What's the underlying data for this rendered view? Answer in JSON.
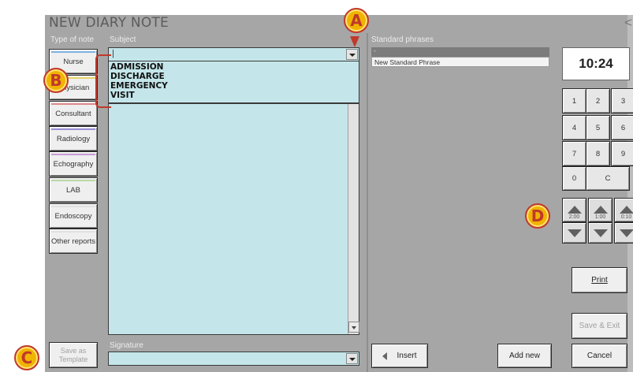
{
  "window": {
    "title": "NEW DIARY NOTE",
    "close_glyph": "<"
  },
  "type_of_note": {
    "label": "Type of note",
    "items": [
      {
        "label": "Nurse",
        "stripe": "#7fb3e0"
      },
      {
        "label": "Physician",
        "stripe": "#e6d36b"
      },
      {
        "label": "Consultant",
        "stripe": "#e08a8a"
      },
      {
        "label": "Radiology",
        "stripe": "#9a8fd6"
      },
      {
        "label": "Echography",
        "stripe": "#c79bd6"
      },
      {
        "label": "LAB",
        "stripe": "#b8d8a8"
      },
      {
        "label": "Endoscopy",
        "stripe": "#e0e0e0"
      },
      {
        "label": "Other reports",
        "stripe": "#e0e0e0"
      }
    ],
    "save_template_label": "Save as Template"
  },
  "subject": {
    "label": "Subject",
    "value": "|",
    "options": [
      "ADMISSION",
      "DISCHARGE",
      "EMERGENCY",
      "VISIT"
    ]
  },
  "signature": {
    "label": "Signature",
    "value": ""
  },
  "standard_phrases": {
    "label": "Standard phrases",
    "items": [
      "-",
      "New Standard Phrase"
    ],
    "insert_label": "Insert",
    "add_new_label": "Add new"
  },
  "time": {
    "value": "10:24",
    "keys": [
      "1",
      "2",
      "3",
      "4",
      "5",
      "6",
      "7",
      "8",
      "9",
      "0",
      "C"
    ],
    "steppers": [
      "2:00",
      "1:00",
      "0:10"
    ]
  },
  "actions": {
    "print_label": "Print",
    "save_exit_label": "Save & Exit",
    "cancel_label": "Cancel"
  },
  "callouts": [
    "A",
    "B",
    "C",
    "D"
  ],
  "colors": {
    "window_bg": "#a6a6a6",
    "text_area_bg": "#c4e6ea",
    "callout_fill": "#f0b400",
    "callout_border": "#c0392b"
  }
}
